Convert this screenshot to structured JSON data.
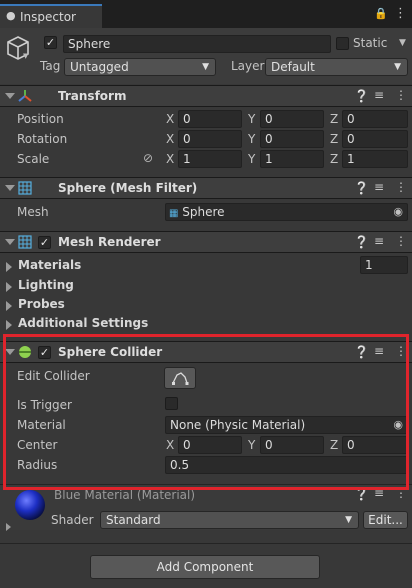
{
  "tab": {
    "title": "Inspector"
  },
  "object": {
    "name": "Sphere",
    "static_label": "Static",
    "tag_label": "Tag",
    "tag_value": "Untagged",
    "layer_label": "Layer",
    "layer_value": "Default"
  },
  "transform": {
    "title": "Transform",
    "rows": [
      {
        "label": "Position",
        "x": "0",
        "y": "0",
        "z": "0"
      },
      {
        "label": "Rotation",
        "x": "0",
        "y": "0",
        "z": "0"
      },
      {
        "label": "Scale",
        "x": "1",
        "y": "1",
        "z": "1"
      }
    ],
    "axis_x": "X",
    "axis_y": "Y",
    "axis_z": "Z"
  },
  "mesh_filter": {
    "title": "Sphere (Mesh Filter)",
    "mesh_label": "Mesh",
    "mesh_value": "Sphere"
  },
  "mesh_renderer": {
    "title": "Mesh Renderer",
    "materials_label": "Materials",
    "materials_count": "1",
    "lighting_label": "Lighting",
    "probes_label": "Probes",
    "additional_label": "Additional Settings"
  },
  "sphere_collider": {
    "title": "Sphere Collider",
    "edit_collider_label": "Edit Collider",
    "is_trigger_label": "Is Trigger",
    "material_label": "Material",
    "material_value": "None (Physic Material)",
    "center_label": "Center",
    "center": {
      "x": "0",
      "y": "0",
      "z": "0"
    },
    "radius_label": "Radius",
    "radius_value": "0.5"
  },
  "material": {
    "title": "Blue Material (Material)",
    "shader_label": "Shader",
    "shader_value": "Standard",
    "edit_label": "Edit..."
  },
  "footer": {
    "add_component": "Add Component"
  },
  "colors": {
    "highlight": "#e0242c",
    "accent": "#3a79bb"
  }
}
